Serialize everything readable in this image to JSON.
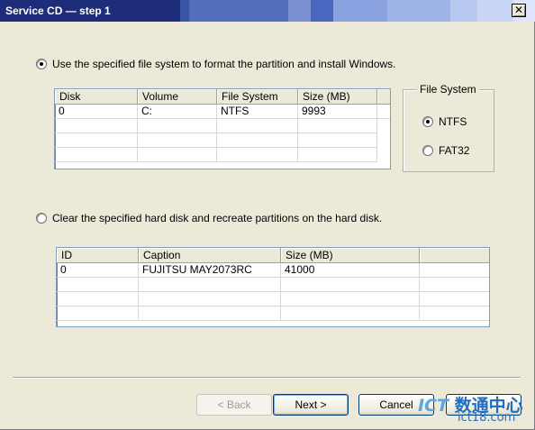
{
  "window": {
    "title": "Service CD — step 1",
    "close_glyph": "✕"
  },
  "option1": {
    "label": "Use the specified file system to format the partition and install Windows.",
    "selected": true,
    "table": {
      "columns": [
        "Disk",
        "Volume",
        "File System",
        "Size (MB)",
        ""
      ],
      "rows": [
        [
          "0",
          "C:",
          "NTFS",
          "9993",
          ""
        ]
      ]
    }
  },
  "file_system_group": {
    "title": "File System",
    "options": [
      {
        "label": "NTFS",
        "selected": true
      },
      {
        "label": "FAT32",
        "selected": false
      }
    ]
  },
  "option2": {
    "label": "Clear the specified hard disk and recreate partitions on the hard disk.",
    "selected": false,
    "table": {
      "columns": [
        "ID",
        "Caption",
        "Size (MB)",
        ""
      ],
      "rows": [
        [
          "0",
          "FUJITSU MAY2073RC",
          "41000",
          ""
        ]
      ]
    }
  },
  "buttons": {
    "back": "< Back",
    "next": "Next >",
    "cancel": "Cancel"
  },
  "watermark": {
    "brand": "ICT",
    "chinese": "数通中心",
    "domain": "ict18.com"
  }
}
